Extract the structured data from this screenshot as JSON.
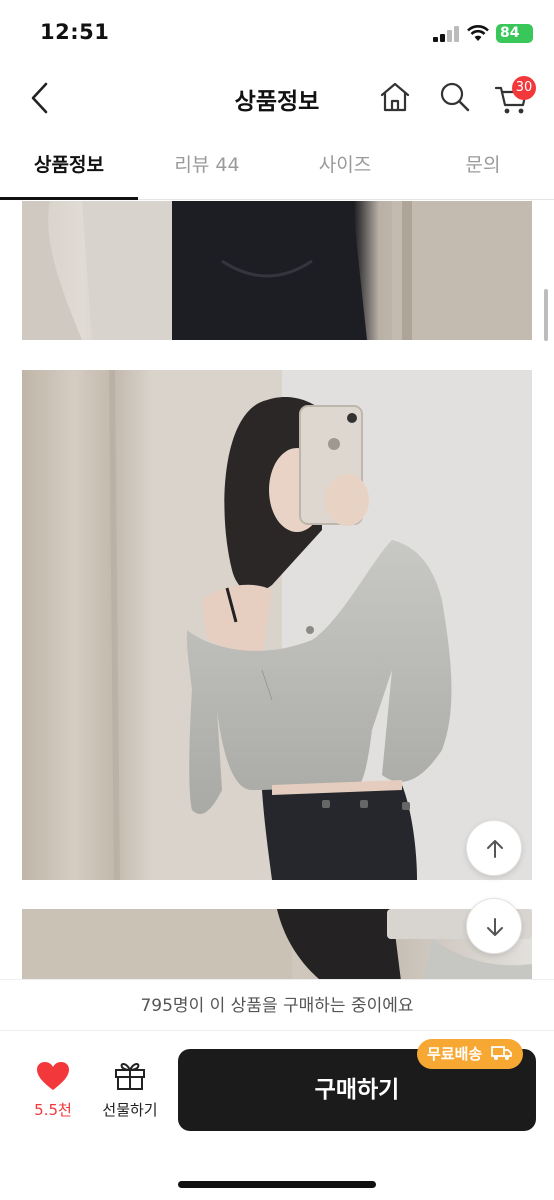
{
  "status_bar": {
    "time": "12:51",
    "battery": "84"
  },
  "header": {
    "title": "상품정보",
    "cart_count": "30"
  },
  "tabs": [
    {
      "label": "상품정보"
    },
    {
      "label": "리뷰 44"
    },
    {
      "label": "사이즈"
    },
    {
      "label": "문의"
    }
  ],
  "notice": {
    "text": "795명이 이 상품을 구매하는 중이에요"
  },
  "bottom_bar": {
    "like_count": "5.5천",
    "gift_label": "선물하기",
    "buy_label": "구매하기",
    "free_shipping_label": "무료배송"
  },
  "colors": {
    "accent_red": "#f3383c",
    "free_shipping_orange": "#f7a832",
    "buy_button": "#1b1b1b",
    "battery_green": "#39c75a"
  },
  "icons": [
    "chevron-left-icon",
    "home-icon",
    "search-icon",
    "cart-icon",
    "heart-icon",
    "gift-icon",
    "arrow-up-icon",
    "arrow-down-icon",
    "truck-icon",
    "wifi-icon",
    "signal-icon",
    "battery-icon"
  ]
}
